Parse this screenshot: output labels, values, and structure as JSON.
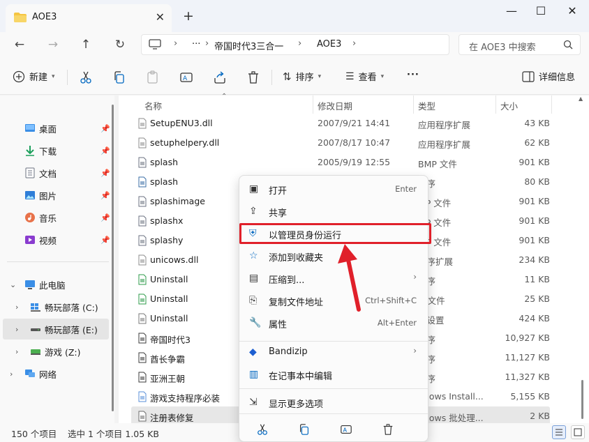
{
  "window": {
    "tab_title": "AOE3",
    "new_tab": "+",
    "tab_close": "✕"
  },
  "address": {
    "ellipsis": "···",
    "crumbs": [
      "帝国时代3三合一",
      "AOE3"
    ],
    "search_placeholder": "在 AOE3 中搜索"
  },
  "toolbar": {
    "new_label": "新建",
    "sort_label": "排序",
    "view_label": "查看",
    "more_label": "···",
    "details_label": "详细信息"
  },
  "sidebar": {
    "quick": [
      {
        "label": "桌面",
        "icon": "desktop-icon"
      },
      {
        "label": "下载",
        "icon": "download-icon"
      },
      {
        "label": "文档",
        "icon": "document-icon"
      },
      {
        "label": "图片",
        "icon": "pictures-icon"
      },
      {
        "label": "音乐",
        "icon": "music-icon"
      },
      {
        "label": "视频",
        "icon": "video-icon"
      }
    ],
    "this_pc": "此电脑",
    "drives": [
      {
        "label": "畅玩部落 (C:)"
      },
      {
        "label": "畅玩部落 (E:)"
      },
      {
        "label": "游戏 (Z:)"
      }
    ],
    "network": "网络"
  },
  "columns": {
    "name": "名称",
    "date": "修改日期",
    "type": "类型",
    "size": "大小"
  },
  "files": [
    {
      "name": "SetupENU3.dll",
      "date": "2007/9/21 14:41",
      "type": "应用程序扩展",
      "size": "43 KB",
      "icon": "dll-icon"
    },
    {
      "name": "setuphelpery.dll",
      "date": "2007/8/17 10:47",
      "type": "应用程序扩展",
      "size": "62 KB",
      "icon": "dll-icon"
    },
    {
      "name": "splash",
      "date": "2005/9/19 12:55",
      "type": "BMP 文件",
      "size": "901 KB",
      "icon": "bmp-icon"
    },
    {
      "name": "splash",
      "date": "",
      "type": "程序",
      "size": "80 KB",
      "icon": "exe-icon"
    },
    {
      "name": "splashimage",
      "date": "",
      "type": "MP 文件",
      "size": "901 KB",
      "icon": "bmp-icon"
    },
    {
      "name": "splashx",
      "date": "",
      "type": "MP 文件",
      "size": "901 KB",
      "icon": "bmp-icon"
    },
    {
      "name": "splashy",
      "date": "",
      "type": "MP 文件",
      "size": "901 KB",
      "icon": "bmp-icon"
    },
    {
      "name": "unicows.dll",
      "date": "",
      "type": "程序扩展",
      "size": "234 KB",
      "icon": "dll-icon"
    },
    {
      "name": "Uninstall",
      "date": "",
      "type": "程序",
      "size": "11 KB",
      "icon": "uninstall-icon"
    },
    {
      "name": "Uninstall",
      "date": "",
      "type": "D 文件",
      "size": "25 KB",
      "icon": "uninstall-icon"
    },
    {
      "name": "Uninstall",
      "date": "",
      "type": "置设置",
      "size": "424 KB",
      "icon": "settings-file-icon"
    },
    {
      "name": "帝国时代3",
      "date": "",
      "type": "程序",
      "size": "10,927 KB",
      "icon": "game-icon"
    },
    {
      "name": "酋长争霸",
      "date": "",
      "type": "程序",
      "size": "11,127 KB",
      "icon": "game-icon"
    },
    {
      "name": "亚洲王朝",
      "date": "",
      "type": "程序",
      "size": "11,327 KB",
      "icon": "game-icon"
    },
    {
      "name": "游戏支持程序必装",
      "date": "",
      "type": "ndows Install...",
      "size": "5,155 KB",
      "icon": "installer-icon"
    },
    {
      "name": "注册表修复",
      "date": "",
      "type": "ndows 批处理...",
      "size": "2 KB",
      "icon": "batch-icon",
      "selected": true
    }
  ],
  "context_menu": {
    "items": [
      {
        "label": "打开",
        "shortcut": "Enter",
        "icon": "open-icon"
      },
      {
        "label": "共享",
        "shortcut": "",
        "icon": "share-icon"
      },
      {
        "label": "以管理员身份运行",
        "shortcut": "",
        "icon": "shield-icon",
        "highlighted": true
      },
      {
        "label": "添加到收藏夹",
        "shortcut": "",
        "icon": "star-icon"
      },
      {
        "label": "压缩到...",
        "shortcut": "",
        "icon": "zip-icon",
        "submenu": true
      },
      {
        "label": "复制文件地址",
        "shortcut": "Ctrl+Shift+C",
        "icon": "copy-path-icon"
      },
      {
        "label": "属性",
        "shortcut": "Alt+Enter",
        "icon": "wrench-icon"
      },
      {
        "label": "Bandizip",
        "shortcut": "",
        "icon": "bandizip-icon",
        "submenu": true
      },
      {
        "label": "在记事本中编辑",
        "shortcut": "",
        "icon": "notepad-icon"
      },
      {
        "label": "显示更多选项",
        "shortcut": "",
        "icon": "more-options-icon"
      }
    ]
  },
  "status": {
    "count": "150 个项目",
    "selected": "选中 1 个项目  1.05 KB"
  },
  "colors": {
    "highlight": "#e0202a",
    "accent": "#0067c0"
  }
}
